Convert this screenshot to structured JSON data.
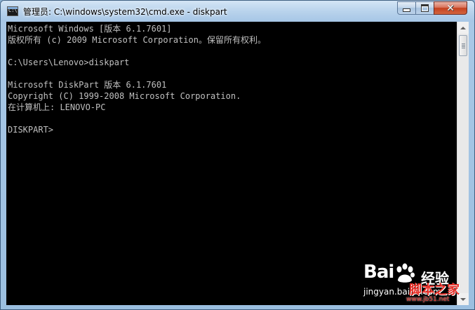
{
  "window": {
    "title": "管理员: C:\\windows\\system32\\cmd.exe - diskpart",
    "icon": "command-prompt-icon",
    "icon_text": "C:\\"
  },
  "titlebar_buttons": {
    "minimize": "minimize-icon",
    "maximize": "maximize-icon",
    "close": "close-icon",
    "close_glyph": "✕",
    "close_color": "#c4401f"
  },
  "console": {
    "background": "#000000",
    "foreground": "#c0c0c0",
    "lines": [
      "Microsoft Windows [版本 6.1.7601]",
      "版权所有 (c) 2009 Microsoft Corporation。保留所有权利。",
      "",
      "C:\\Users\\Lenovo>diskpart",
      "",
      "Microsoft DiskPart 版本 6.1.7601",
      "Copyright (C) 1999-2008 Microsoft Corporation.",
      "在计算机上: LENOVO-PC",
      "",
      "DISKPART>"
    ]
  },
  "scrollbar": {
    "up_icon": "scroll-up-arrow-icon",
    "down_icon": "scroll-down-arrow-icon"
  },
  "watermarks": {
    "baidu_logo": "Bai",
    "baidu_logo_suffix": "",
    "baidu_paw_icon": "baidu-paw-icon",
    "baidu_jingyan": "经验",
    "baidu_url": "jingyan.baidu.com",
    "jb51_name": "脚本之家",
    "jb51_url": "www.jb51.net",
    "jb51_color": "#e8312a"
  }
}
